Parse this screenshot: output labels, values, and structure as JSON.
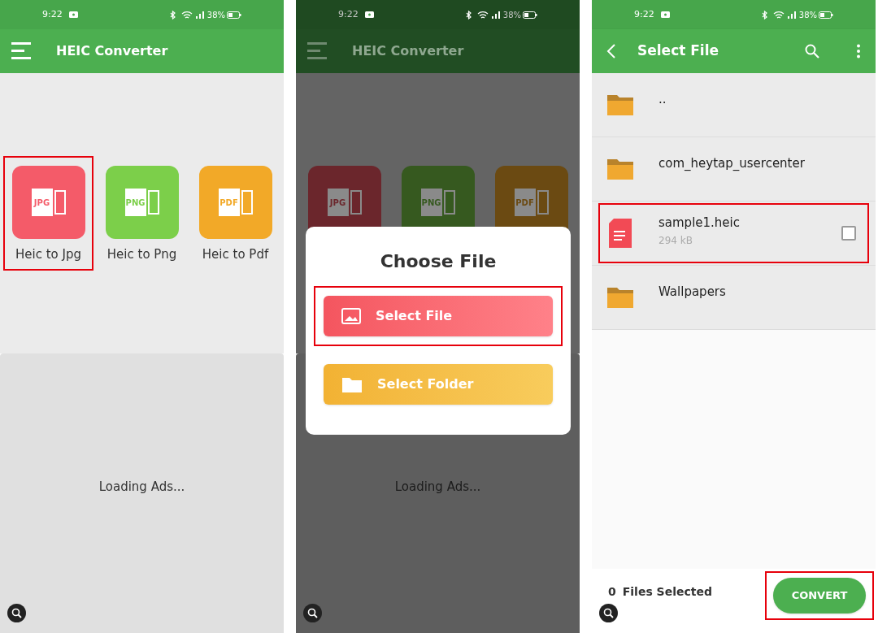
{
  "screens": [
    {
      "kind": "home",
      "dimmed": false,
      "status_bar": {
        "time": "9:22",
        "battery": "38%"
      },
      "toolbar": {
        "title": "HEIC Converter"
      },
      "tiles": [
        {
          "badge": "JPG",
          "label": "Heic to Jpg",
          "color": "#f45b69",
          "highlighted": true
        },
        {
          "badge": "PNG",
          "label": "Heic to Png",
          "color": "#7ccf4a",
          "highlighted": false
        },
        {
          "badge": "PDF",
          "label": "Heic to Pdf",
          "color": "#f2a928",
          "highlighted": false
        }
      ],
      "ads": {
        "text": "Loading Ads..."
      }
    },
    {
      "kind": "home",
      "dimmed": true,
      "status_bar": {
        "time": "9:22",
        "battery": "38%"
      },
      "toolbar": {
        "title": "HEIC Converter"
      },
      "tiles": [
        {
          "badge": "JPG",
          "color": "#6b262c",
          "highlighted": false
        },
        {
          "badge": "PNG",
          "color": "#36591f",
          "highlighted": false
        },
        {
          "badge": "PDF",
          "color": "#6b4a12",
          "highlighted": false
        }
      ],
      "ads": {
        "text": "Loading Ads..."
      },
      "dialog": {
        "title": "Choose File",
        "buttons": [
          {
            "kind": "file",
            "label": "Select File",
            "highlighted": true
          },
          {
            "kind": "folder",
            "label": "Select Folder",
            "highlighted": false
          }
        ]
      }
    },
    {
      "kind": "file_picker",
      "status_bar": {
        "time": "9:22",
        "battery": "38%"
      },
      "toolbar": {
        "title": "Select File"
      },
      "files": [
        {
          "kind": "folder",
          "name": ".."
        },
        {
          "kind": "folder",
          "name": "com_heytap_usercenter"
        },
        {
          "kind": "file",
          "name": "sample1.heic",
          "size": "294 kB",
          "checked": false,
          "highlighted": true
        },
        {
          "kind": "folder",
          "name": "Wallpapers"
        }
      ],
      "footer": {
        "count": "0",
        "label": "Files Selected",
        "button": "CONVERT",
        "button_highlighted": true
      }
    }
  ]
}
